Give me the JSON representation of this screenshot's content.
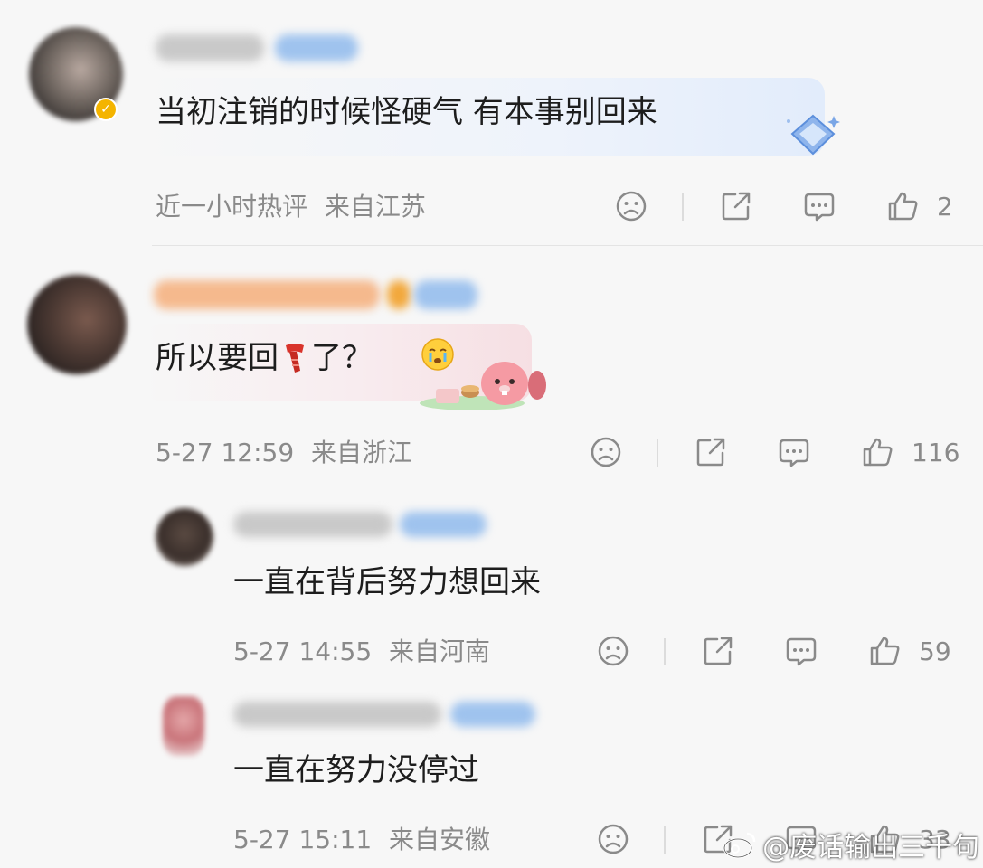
{
  "comments": [
    {
      "text": "当初注销的时候怪硬气 有本事别回来",
      "time": "近一小时热评",
      "location": "来自江苏",
      "likes": "2"
    },
    {
      "text_before": "所以要回",
      "text_after": "了？",
      "time": "5-27 12:59",
      "location": "来自浙江",
      "likes": "116"
    }
  ],
  "replies": [
    {
      "text": "一直在背后努力想回来",
      "time": "5-27 14:55",
      "location": "来自河南",
      "likes": "59"
    },
    {
      "text": "一直在努力没停过",
      "time": "5-27 15:11",
      "location": "来自安徽",
      "likes": "33"
    }
  ],
  "watermark": "@废话输出三千句",
  "icons": {
    "dislike": "sad-face-icon",
    "share": "share-icon",
    "comment": "comment-icon",
    "like": "thumbs-up-icon"
  },
  "colors": {
    "meta_text": "#8a8a8a",
    "blur_name_blue": "#9fc3ee",
    "blur_name_orange": "#f5b98d"
  }
}
